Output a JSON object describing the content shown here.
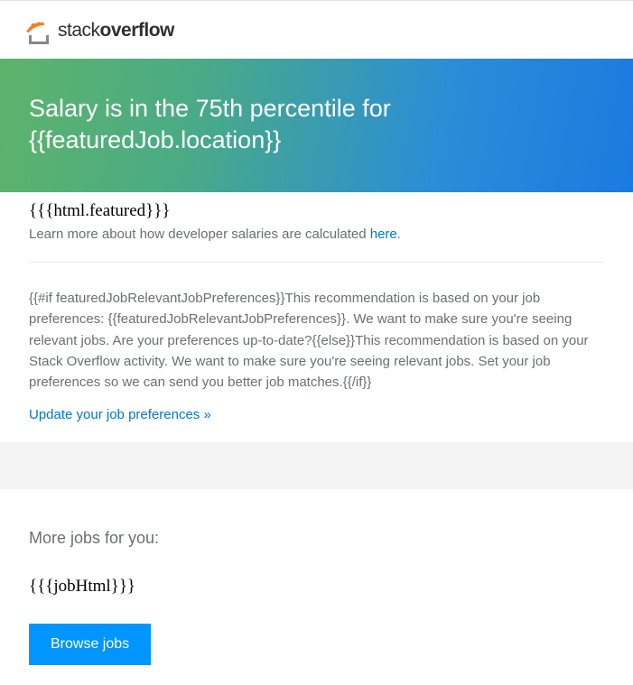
{
  "logo": {
    "text_light": "stack",
    "text_bold": "overflow"
  },
  "hero": {
    "title": "Salary is in the 75th percentile for {{featuredJob.location}}"
  },
  "content": {
    "featured_placeholder": "{{{html.featured}}}",
    "learn_more_prefix": "Learn more about how developer salaries are calculated ",
    "learn_more_link": "here",
    "learn_more_suffix": ".",
    "recommendation_text": "{{#if featuredJobRelevantJobPreferences}}This recommendation is based on your job preferences: {{featuredJobRelevantJobPreferences}}. We want to make sure you're seeing relevant jobs. Are your preferences up-to-date?{{else}}This recommendation is based on your Stack Overflow activity. We want to make sure you're seeing relevant jobs. Set your job preferences so we can send you better job matches.{{/if}}",
    "update_link": "Update your job preferences »"
  },
  "more_jobs": {
    "title": "More jobs for you:",
    "job_html_placeholder": "{{{jobHtml}}}",
    "browse_button": "Browse jobs"
  }
}
